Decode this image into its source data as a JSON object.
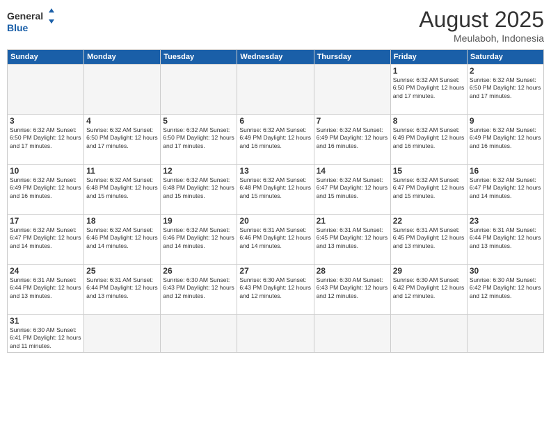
{
  "header": {
    "logo_general": "General",
    "logo_blue": "Blue",
    "month_year": "August 2025",
    "location": "Meulaboh, Indonesia"
  },
  "weekdays": [
    "Sunday",
    "Monday",
    "Tuesday",
    "Wednesday",
    "Thursday",
    "Friday",
    "Saturday"
  ],
  "weeks": [
    [
      {
        "day": "",
        "info": ""
      },
      {
        "day": "",
        "info": ""
      },
      {
        "day": "",
        "info": ""
      },
      {
        "day": "",
        "info": ""
      },
      {
        "day": "",
        "info": ""
      },
      {
        "day": "1",
        "info": "Sunrise: 6:32 AM\nSunset: 6:50 PM\nDaylight: 12 hours and 17 minutes."
      },
      {
        "day": "2",
        "info": "Sunrise: 6:32 AM\nSunset: 6:50 PM\nDaylight: 12 hours and 17 minutes."
      }
    ],
    [
      {
        "day": "3",
        "info": "Sunrise: 6:32 AM\nSunset: 6:50 PM\nDaylight: 12 hours and 17 minutes."
      },
      {
        "day": "4",
        "info": "Sunrise: 6:32 AM\nSunset: 6:50 PM\nDaylight: 12 hours and 17 minutes."
      },
      {
        "day": "5",
        "info": "Sunrise: 6:32 AM\nSunset: 6:50 PM\nDaylight: 12 hours and 17 minutes."
      },
      {
        "day": "6",
        "info": "Sunrise: 6:32 AM\nSunset: 6:49 PM\nDaylight: 12 hours and 16 minutes."
      },
      {
        "day": "7",
        "info": "Sunrise: 6:32 AM\nSunset: 6:49 PM\nDaylight: 12 hours and 16 minutes."
      },
      {
        "day": "8",
        "info": "Sunrise: 6:32 AM\nSunset: 6:49 PM\nDaylight: 12 hours and 16 minutes."
      },
      {
        "day": "9",
        "info": "Sunrise: 6:32 AM\nSunset: 6:49 PM\nDaylight: 12 hours and 16 minutes."
      }
    ],
    [
      {
        "day": "10",
        "info": "Sunrise: 6:32 AM\nSunset: 6:49 PM\nDaylight: 12 hours and 16 minutes."
      },
      {
        "day": "11",
        "info": "Sunrise: 6:32 AM\nSunset: 6:48 PM\nDaylight: 12 hours and 15 minutes."
      },
      {
        "day": "12",
        "info": "Sunrise: 6:32 AM\nSunset: 6:48 PM\nDaylight: 12 hours and 15 minutes."
      },
      {
        "day": "13",
        "info": "Sunrise: 6:32 AM\nSunset: 6:48 PM\nDaylight: 12 hours and 15 minutes."
      },
      {
        "day": "14",
        "info": "Sunrise: 6:32 AM\nSunset: 6:47 PM\nDaylight: 12 hours and 15 minutes."
      },
      {
        "day": "15",
        "info": "Sunrise: 6:32 AM\nSunset: 6:47 PM\nDaylight: 12 hours and 15 minutes."
      },
      {
        "day": "16",
        "info": "Sunrise: 6:32 AM\nSunset: 6:47 PM\nDaylight: 12 hours and 14 minutes."
      }
    ],
    [
      {
        "day": "17",
        "info": "Sunrise: 6:32 AM\nSunset: 6:47 PM\nDaylight: 12 hours and 14 minutes."
      },
      {
        "day": "18",
        "info": "Sunrise: 6:32 AM\nSunset: 6:46 PM\nDaylight: 12 hours and 14 minutes."
      },
      {
        "day": "19",
        "info": "Sunrise: 6:32 AM\nSunset: 6:46 PM\nDaylight: 12 hours and 14 minutes."
      },
      {
        "day": "20",
        "info": "Sunrise: 6:31 AM\nSunset: 6:46 PM\nDaylight: 12 hours and 14 minutes."
      },
      {
        "day": "21",
        "info": "Sunrise: 6:31 AM\nSunset: 6:45 PM\nDaylight: 12 hours and 13 minutes."
      },
      {
        "day": "22",
        "info": "Sunrise: 6:31 AM\nSunset: 6:45 PM\nDaylight: 12 hours and 13 minutes."
      },
      {
        "day": "23",
        "info": "Sunrise: 6:31 AM\nSunset: 6:44 PM\nDaylight: 12 hours and 13 minutes."
      }
    ],
    [
      {
        "day": "24",
        "info": "Sunrise: 6:31 AM\nSunset: 6:44 PM\nDaylight: 12 hours and 13 minutes."
      },
      {
        "day": "25",
        "info": "Sunrise: 6:31 AM\nSunset: 6:44 PM\nDaylight: 12 hours and 13 minutes."
      },
      {
        "day": "26",
        "info": "Sunrise: 6:30 AM\nSunset: 6:43 PM\nDaylight: 12 hours and 12 minutes."
      },
      {
        "day": "27",
        "info": "Sunrise: 6:30 AM\nSunset: 6:43 PM\nDaylight: 12 hours and 12 minutes."
      },
      {
        "day": "28",
        "info": "Sunrise: 6:30 AM\nSunset: 6:43 PM\nDaylight: 12 hours and 12 minutes."
      },
      {
        "day": "29",
        "info": "Sunrise: 6:30 AM\nSunset: 6:42 PM\nDaylight: 12 hours and 12 minutes."
      },
      {
        "day": "30",
        "info": "Sunrise: 6:30 AM\nSunset: 6:42 PM\nDaylight: 12 hours and 12 minutes."
      }
    ],
    [
      {
        "day": "31",
        "info": "Sunrise: 6:30 AM\nSunset: 6:41 PM\nDaylight: 12 hours and 11 minutes."
      },
      {
        "day": "",
        "info": ""
      },
      {
        "day": "",
        "info": ""
      },
      {
        "day": "",
        "info": ""
      },
      {
        "day": "",
        "info": ""
      },
      {
        "day": "",
        "info": ""
      },
      {
        "day": "",
        "info": ""
      }
    ]
  ]
}
